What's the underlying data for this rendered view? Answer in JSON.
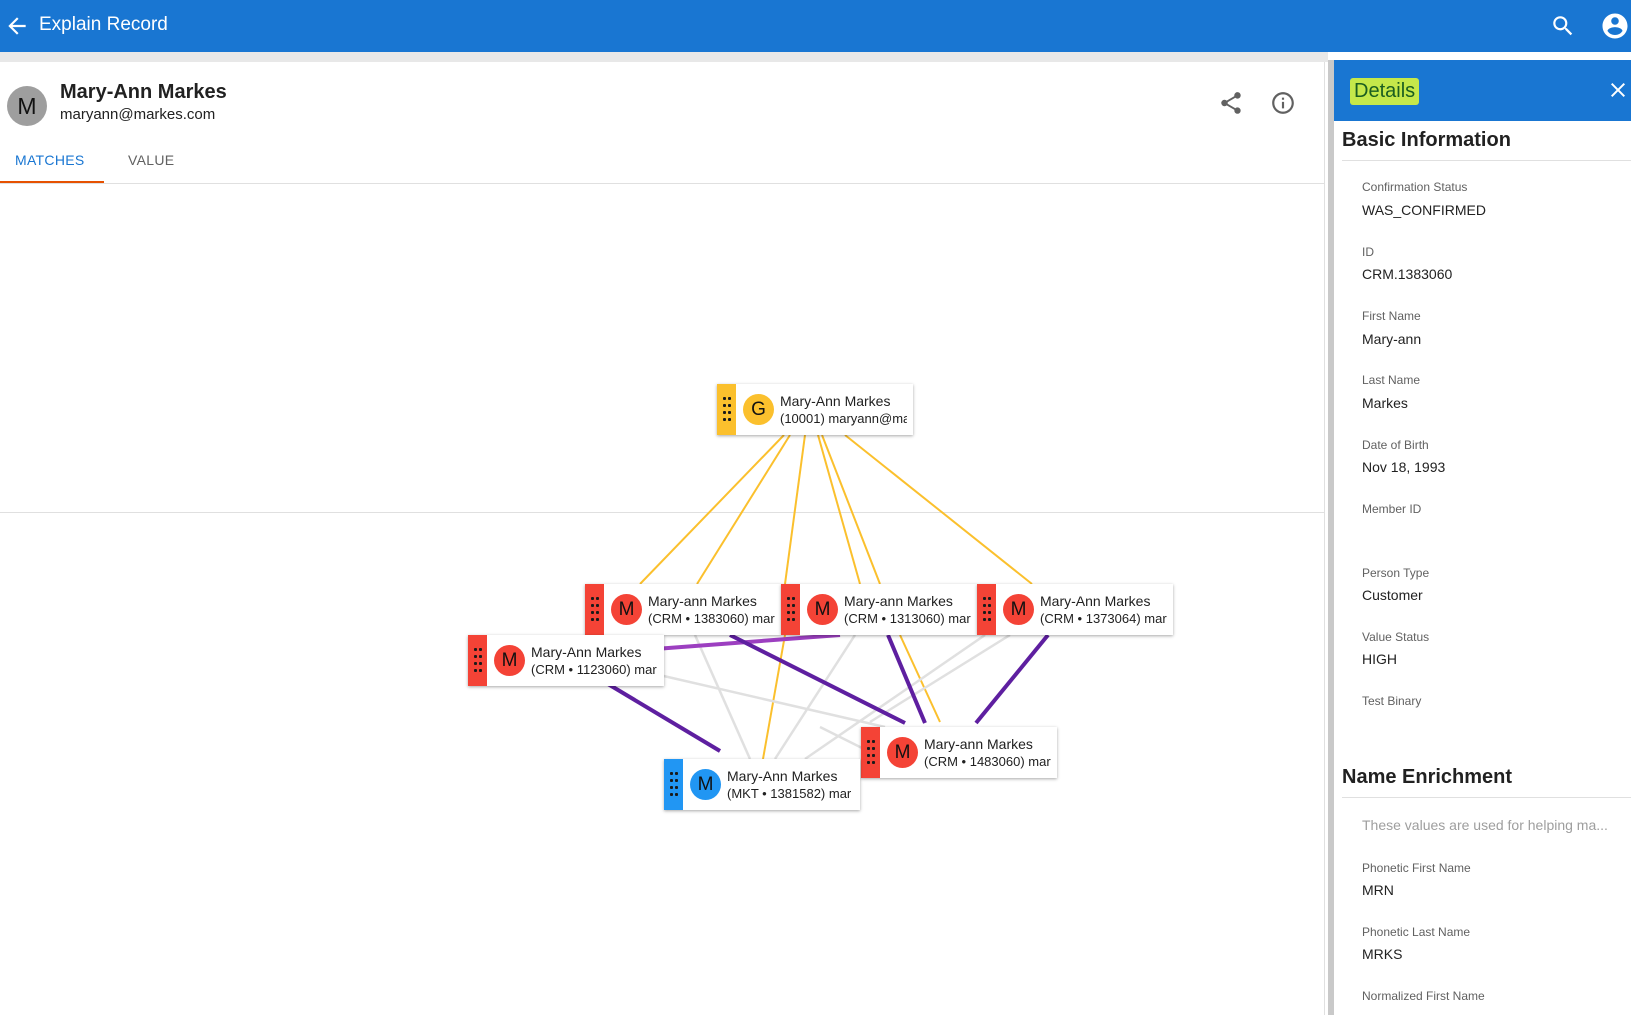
{
  "appbar": {
    "title": "Explain Record"
  },
  "record": {
    "avatar_letter": "M",
    "name": "Mary-Ann Markes",
    "email": "maryann@markes.com"
  },
  "tabs": [
    {
      "label": "MATCHES"
    },
    {
      "label": "VALUE"
    }
  ],
  "graph": {
    "nodes": [
      {
        "id": "golden",
        "color": "#fbc02d",
        "letter": "G",
        "line1": "Mary-Ann Markes",
        "line2": "(10001) maryann@ma"
      },
      {
        "id": "crm1383060",
        "color": "#f44336",
        "letter": "M",
        "line1": "Mary-ann Markes",
        "line2": "(CRM • 1383060) mar"
      },
      {
        "id": "crm1313060",
        "color": "#f44336",
        "letter": "M",
        "line1": "Mary-ann Markes",
        "line2": "(CRM • 1313060) mar"
      },
      {
        "id": "crm1373064",
        "color": "#f44336",
        "letter": "M",
        "line1": "Mary-Ann Markes",
        "line2": "(CRM • 1373064) mar"
      },
      {
        "id": "crm1123060",
        "color": "#f44336",
        "letter": "M",
        "line1": "Mary-Ann Markes",
        "line2": "(CRM • 1123060) mar"
      },
      {
        "id": "crm1483060",
        "color": "#f44336",
        "letter": "M",
        "line1": "Mary-ann Markes",
        "line2": "(CRM • 1483060) mar"
      },
      {
        "id": "mkt1381582",
        "color": "#2196f3",
        "letter": "M",
        "line1": "Mary-Ann Markes",
        "line2": "(MKT • 1381582) mar"
      }
    ],
    "edge_colors": {
      "golden": "#fbc02d",
      "strong": "#5e1fa0",
      "medium": "#9c3fc0",
      "weak": "#e0e0e0"
    }
  },
  "details": {
    "title": "Details",
    "basic": {
      "heading": "Basic Information",
      "fields": [
        {
          "label": "Confirmation Status",
          "value": "WAS_CONFIRMED"
        },
        {
          "label": "ID",
          "value": "CRM.1383060"
        },
        {
          "label": "First Name",
          "value": "Mary-ann"
        },
        {
          "label": "Last Name",
          "value": "Markes"
        },
        {
          "label": "Date of Birth",
          "value": "Nov 18, 1993"
        },
        {
          "label": "Member ID",
          "value": ""
        },
        {
          "label": "Person Type",
          "value": "Customer"
        },
        {
          "label": "Value Status",
          "value": "HIGH"
        },
        {
          "label": "Test Binary",
          "value": ""
        }
      ]
    },
    "enrichment": {
      "heading": "Name Enrichment",
      "note": "These values are used for helping ma...",
      "fields": [
        {
          "label": "Phonetic First Name",
          "value": "MRN"
        },
        {
          "label": "Phonetic Last Name",
          "value": "MRKS"
        },
        {
          "label": "Normalized First Name",
          "value": ""
        }
      ]
    }
  }
}
